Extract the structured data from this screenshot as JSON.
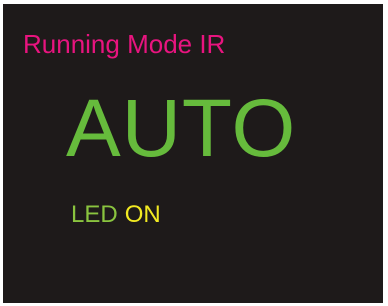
{
  "display": {
    "title": "Running Mode IR",
    "mode": "AUTO",
    "led_label": "LED",
    "led_state": "ON"
  },
  "colors": {
    "background": "#1e1a1a",
    "title": "#e8147f",
    "mode": "#66bb3c",
    "led_label": "#8ac43f",
    "led_state": "#f2ea22"
  }
}
